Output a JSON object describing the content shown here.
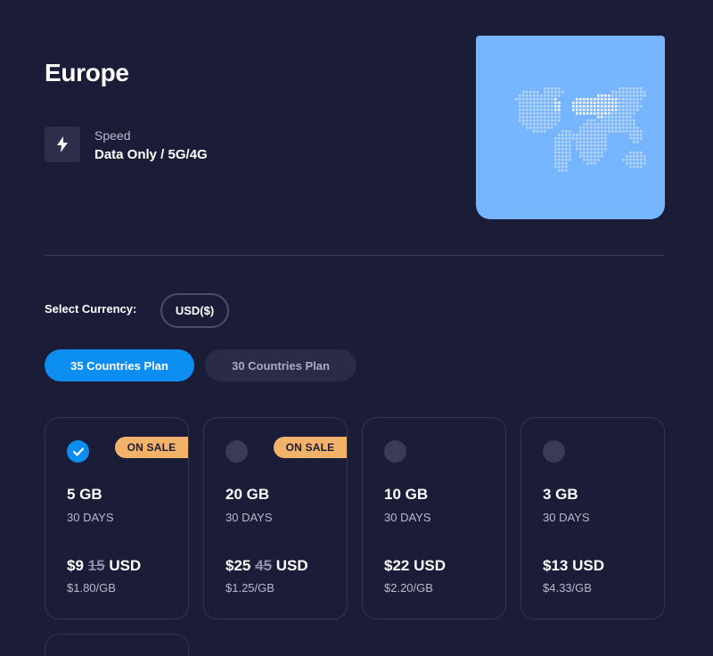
{
  "header": {
    "title": "Europe",
    "speed_label": "Speed",
    "speed_value": "Data Only / 5G/4G"
  },
  "icons": {
    "speed": "lightning-bolt-icon",
    "map": "world-map-icon",
    "check": "checkmark-icon"
  },
  "currency": {
    "label": "Select Currency:",
    "selected": "USD($)"
  },
  "tabs": [
    {
      "label": "35 Countries Plan",
      "active": true
    },
    {
      "label": "30 Countries Plan",
      "active": false
    }
  ],
  "plans": [
    {
      "data": "5 GB",
      "duration": "30 DAYS",
      "price": "$9",
      "old_price": "15",
      "currency": "USD",
      "per_gb": "$1.80/GB",
      "badge": "ON SALE",
      "selected": true
    },
    {
      "data": "20 GB",
      "duration": "30 DAYS",
      "price": "$25",
      "old_price": "45",
      "currency": "USD",
      "per_gb": "$1.25/GB",
      "badge": "ON SALE",
      "selected": false
    },
    {
      "data": "10 GB",
      "duration": "30 DAYS",
      "price": "$22",
      "old_price": "",
      "currency": "USD",
      "per_gb": "$2.20/GB",
      "badge": "",
      "selected": false
    },
    {
      "data": "3 GB",
      "duration": "30 DAYS",
      "price": "$13",
      "old_price": "",
      "currency": "USD",
      "per_gb": "$4.33/GB",
      "badge": "",
      "selected": false
    }
  ],
  "colors": {
    "background": "#1b1c37",
    "accent": "#0b8ef0",
    "sale": "#f2b26a",
    "map_card": "#76b5ff"
  }
}
